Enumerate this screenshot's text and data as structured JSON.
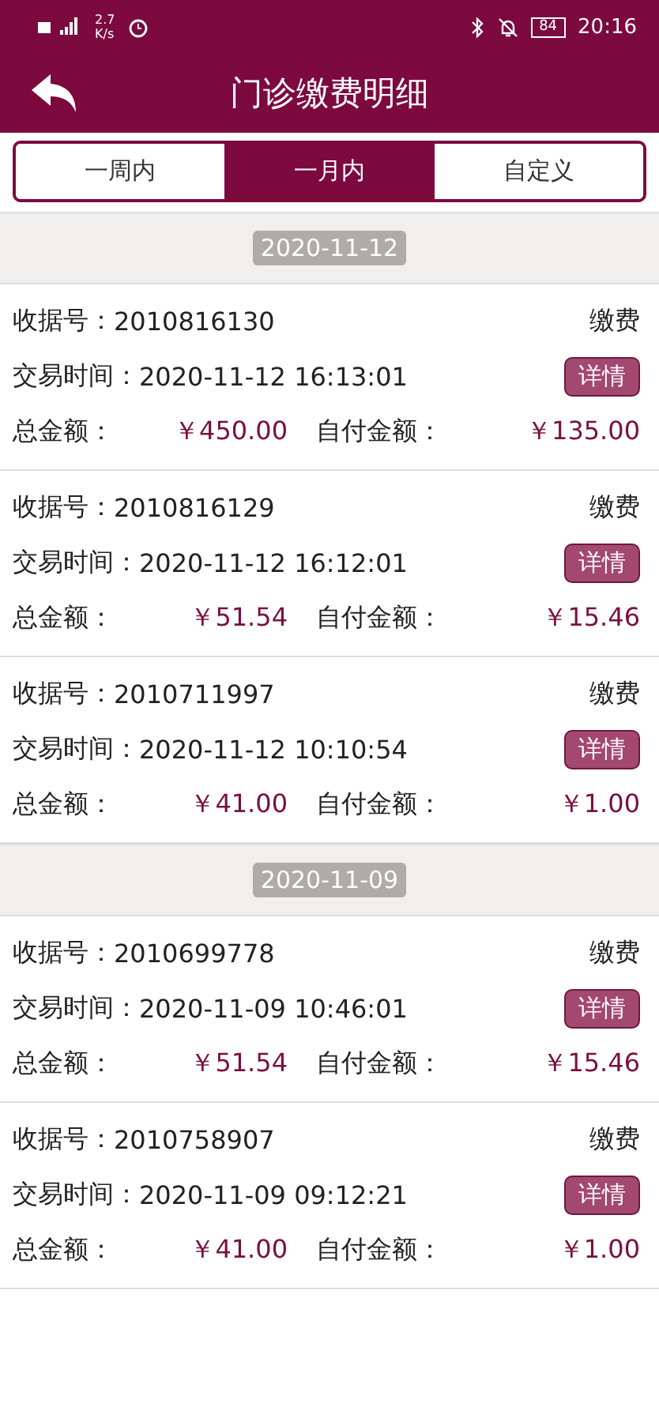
{
  "status_bar": {
    "speed_value": "2.7",
    "speed_unit": "K/s",
    "battery": "84",
    "time": "20:16"
  },
  "header": {
    "title": "门诊缴费明细"
  },
  "tabs": [
    {
      "label": "一周内",
      "selected": false
    },
    {
      "label": "一月内",
      "selected": true
    },
    {
      "label": "自定义",
      "selected": false
    }
  ],
  "groups": [
    {
      "date": "2020-11-12",
      "records": [
        {
          "receipt_label": "收据号：",
          "receipt_no": "2010816130",
          "type": "缴费",
          "time_label": "交易时间：",
          "time": "2020-11-12 16:13:01",
          "detail_button": "详情",
          "total_label": "总金额：",
          "total": "￥450.00",
          "self_label": "自付金额：",
          "self_paid": "￥135.00"
        },
        {
          "receipt_label": "收据号：",
          "receipt_no": "2010816129",
          "type": "缴费",
          "time_label": "交易时间：",
          "time": "2020-11-12 16:12:01",
          "detail_button": "详情",
          "total_label": "总金额：",
          "total": "￥51.54",
          "self_label": "自付金额：",
          "self_paid": "￥15.46"
        },
        {
          "receipt_label": "收据号：",
          "receipt_no": "2010711997",
          "type": "缴费",
          "time_label": "交易时间：",
          "time": "2020-11-12 10:10:54",
          "detail_button": "详情",
          "total_label": "总金额：",
          "total": "￥41.00",
          "self_label": "自付金额：",
          "self_paid": "￥1.00"
        }
      ]
    },
    {
      "date": "2020-11-09",
      "records": [
        {
          "receipt_label": "收据号：",
          "receipt_no": "2010699778",
          "type": "缴费",
          "time_label": "交易时间：",
          "time": "2020-11-09 10:46:01",
          "detail_button": "详情",
          "total_label": "总金额：",
          "total": "￥51.54",
          "self_label": "自付金额：",
          "self_paid": "￥15.46"
        },
        {
          "receipt_label": "收据号：",
          "receipt_no": "2010758907",
          "type": "缴费",
          "time_label": "交易时间：",
          "time": "2020-11-09 09:12:21",
          "detail_button": "详情",
          "total_label": "总金额：",
          "total": "￥41.00",
          "self_label": "自付金额：",
          "self_paid": "￥1.00"
        }
      ]
    }
  ]
}
